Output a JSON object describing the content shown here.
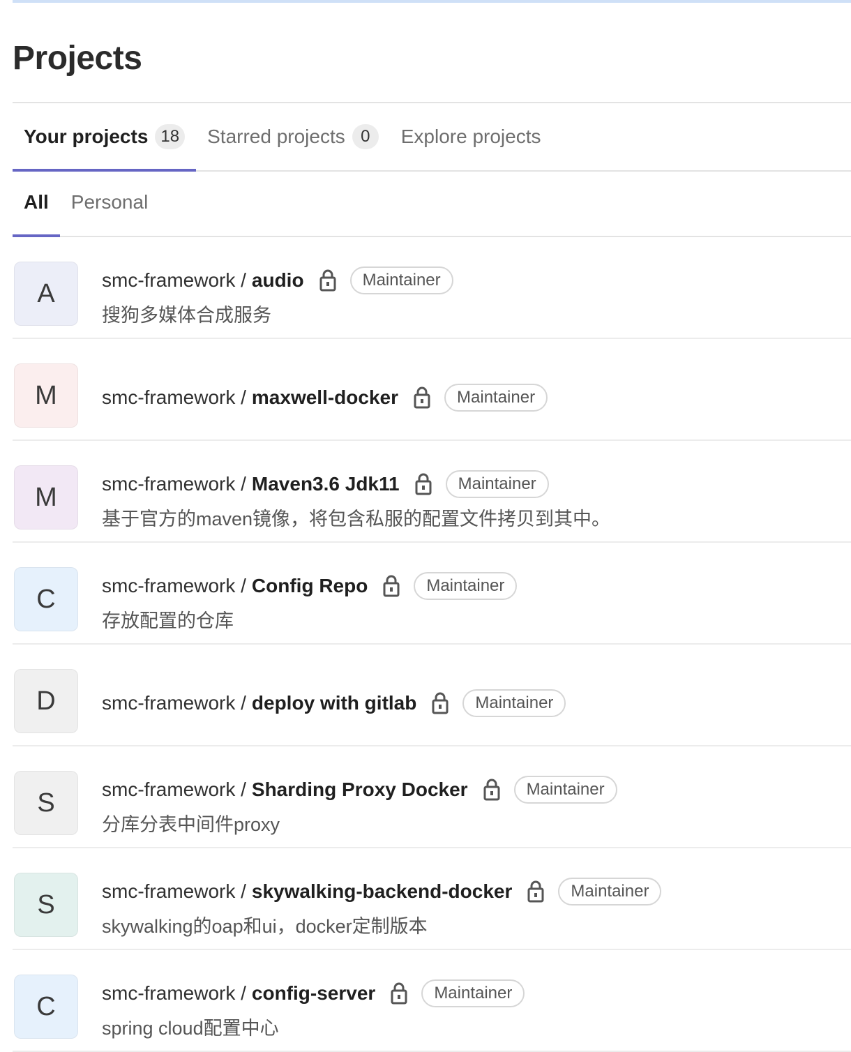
{
  "page": {
    "title": "Projects"
  },
  "tabs": [
    {
      "label": "Your projects",
      "count": "18",
      "active": true
    },
    {
      "label": "Starred projects",
      "count": "0",
      "active": false
    },
    {
      "label": "Explore projects",
      "count": null,
      "active": false
    }
  ],
  "filters": [
    {
      "label": "All",
      "active": true
    },
    {
      "label": "Personal",
      "active": false
    }
  ],
  "projects": [
    {
      "avatar_letter": "A",
      "avatar_color": "#eceef8",
      "namespace": "smc-framework /",
      "name": "audio",
      "visibility_icon": "lock-icon",
      "role": "Maintainer",
      "description": "搜狗多媒体合成服务"
    },
    {
      "avatar_letter": "M",
      "avatar_color": "#fbeeee",
      "namespace": "smc-framework /",
      "name": "maxwell-docker",
      "visibility_icon": "lock-icon",
      "role": "Maintainer",
      "description": ""
    },
    {
      "avatar_letter": "M",
      "avatar_color": "#f2e8f5",
      "namespace": "smc-framework /",
      "name": "Maven3.6 Jdk11",
      "visibility_icon": "lock-icon",
      "role": "Maintainer",
      "description": "基于官方的maven镜像，将包含私服的配置文件拷贝到其中。"
    },
    {
      "avatar_letter": "C",
      "avatar_color": "#e6f1fc",
      "namespace": "smc-framework /",
      "name": "Config Repo",
      "visibility_icon": "lock-icon",
      "role": "Maintainer",
      "description": "存放配置的仓库"
    },
    {
      "avatar_letter": "D",
      "avatar_color": "#f0f0f0",
      "namespace": "smc-framework /",
      "name": "deploy with gitlab",
      "visibility_icon": "lock-icon",
      "role": "Maintainer",
      "description": ""
    },
    {
      "avatar_letter": "S",
      "avatar_color": "#f0f0f0",
      "namespace": "smc-framework /",
      "name": "Sharding Proxy Docker",
      "visibility_icon": "lock-icon",
      "role": "Maintainer",
      "description": "分库分表中间件proxy"
    },
    {
      "avatar_letter": "S",
      "avatar_color": "#e3f1ee",
      "namespace": "smc-framework /",
      "name": "skywalking-backend-docker",
      "visibility_icon": "lock-icon",
      "role": "Maintainer",
      "description": "skywalking的oap和ui，docker定制版本"
    },
    {
      "avatar_letter": "C",
      "avatar_color": "#e6f1fc",
      "namespace": "smc-framework /",
      "name": "config-server",
      "visibility_icon": "lock-icon",
      "role": "Maintainer",
      "description": "spring cloud配置中心"
    }
  ]
}
